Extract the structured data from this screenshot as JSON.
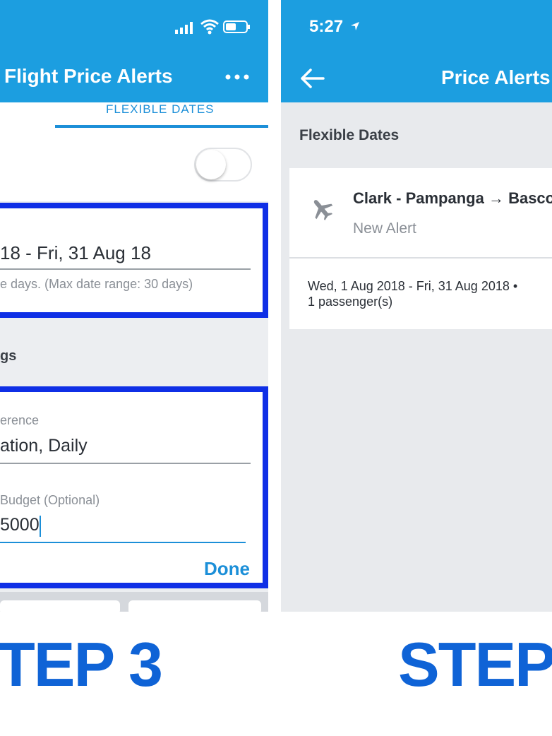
{
  "left": {
    "title": "Flight Price Alerts",
    "tab": "FLEXIBLE DATES",
    "date_value": "18 - Fri, 31 Aug 18",
    "date_hint": "e days. (Max date range: 30 days)",
    "section": "gs",
    "pref_label": "erence",
    "pref_value": "ation, Daily",
    "budget_label": "Budget (Optional)",
    "budget_value": "5000",
    "done": "Done",
    "step": "TEP 3"
  },
  "right": {
    "time": "5:27",
    "title": "Price Alerts",
    "section": "Flexible Dates",
    "route": "Clark - Pampanga → Basco",
    "status": "New Alert",
    "dates": "Wed, 1 Aug 2018 - Fri, 31 Aug 2018 •",
    "passengers": "1 passenger(s)",
    "step": "STEP"
  },
  "colors": {
    "brand": "#1c9ee0",
    "highlight": "#0f2fe6",
    "step_text": "#0f63d6"
  },
  "icons": [
    "signal-icon",
    "wifi-icon",
    "battery-icon",
    "more-icon",
    "location-arrow-icon",
    "back-arrow-icon",
    "airplane-icon"
  ]
}
